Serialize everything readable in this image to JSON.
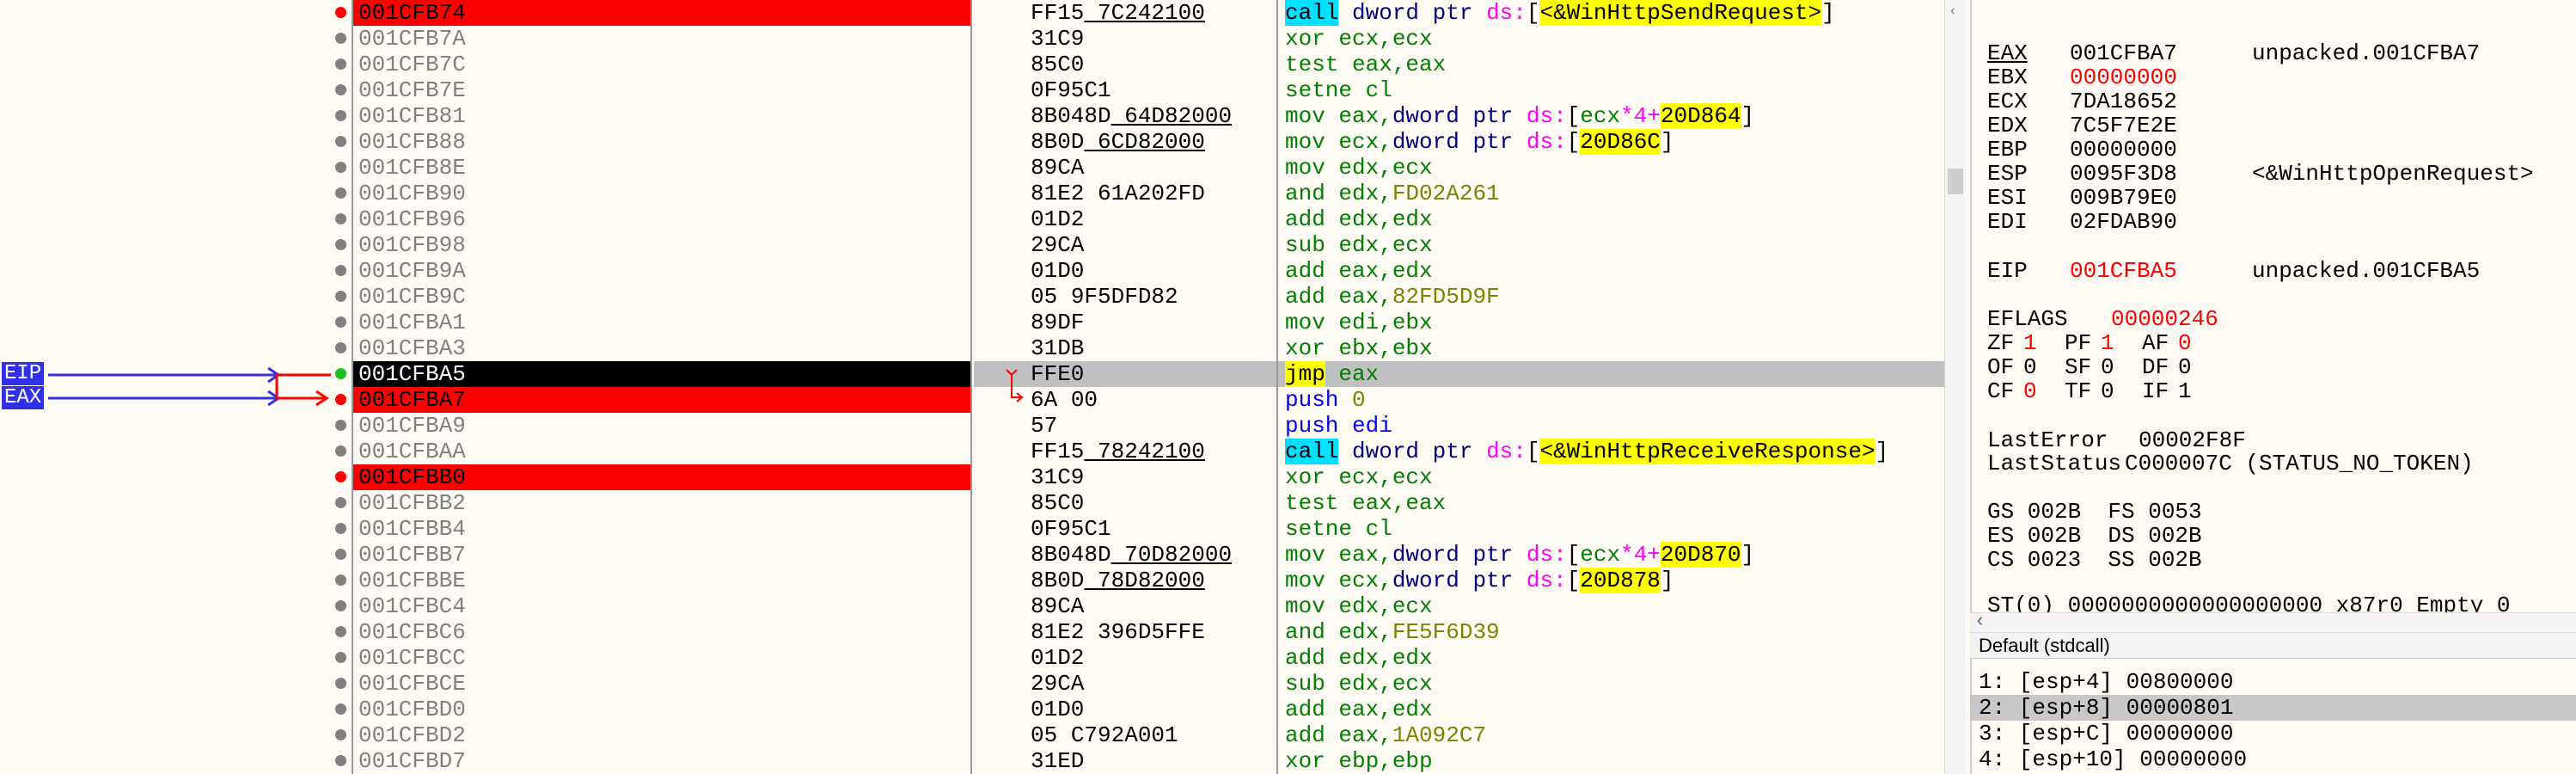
{
  "disasm": {
    "rows": [
      {
        "addr": "001CFB74",
        "bytes": "FF15 7C242100",
        "bp": "red",
        "addr_style": "bp",
        "instr": [
          [
            "call",
            "kw-call"
          ],
          [
            " dword ptr ",
            "ptr"
          ],
          [
            "ds:",
            "seg"
          ],
          [
            "[",
            "plain"
          ],
          [
            "<&WinHttpSendRequest>",
            "hl"
          ],
          [
            "]",
            "plain"
          ]
        ]
      },
      {
        "addr": "001CFB7A",
        "bytes": "31C9",
        "instr": [
          [
            "xor ecx,ecx",
            "k-mov"
          ]
        ]
      },
      {
        "addr": "001CFB7C",
        "bytes": "85C0",
        "instr": [
          [
            "test eax,eax",
            "k-mov"
          ]
        ]
      },
      {
        "addr": "001CFB7E",
        "bytes": "0F95C1",
        "instr": [
          [
            "setne cl",
            "k-mov"
          ]
        ]
      },
      {
        "addr": "001CFB81",
        "bytes": "8B048D 64D82000",
        "instr": [
          [
            "mov eax,",
            "k-mov"
          ],
          [
            "dword ptr ",
            "ptr"
          ],
          [
            "ds:",
            "seg"
          ],
          [
            "[",
            "plain"
          ],
          [
            "ecx",
            "k-mov"
          ],
          [
            "*4+",
            "seg"
          ],
          [
            "20D864",
            "hlc"
          ],
          [
            "]",
            "plain"
          ]
        ]
      },
      {
        "addr": "001CFB88",
        "bytes": "8B0D 6CD82000",
        "instr": [
          [
            "mov ecx,",
            "k-mov"
          ],
          [
            "dword ptr ",
            "ptr"
          ],
          [
            "ds:",
            "seg"
          ],
          [
            "[",
            "plain"
          ],
          [
            "20D86C",
            "hlc"
          ],
          [
            "]",
            "plain"
          ]
        ]
      },
      {
        "addr": "001CFB8E",
        "bytes": "89CA",
        "instr": [
          [
            "mov edx,ecx",
            "k-mov"
          ]
        ]
      },
      {
        "addr": "001CFB90",
        "bytes": "81E2 61A202FD",
        "instr": [
          [
            "and edx,",
            "k-mov"
          ],
          [
            "FD02A261",
            "num"
          ]
        ]
      },
      {
        "addr": "001CFB96",
        "bytes": "01D2",
        "instr": [
          [
            "add edx,edx",
            "k-mov"
          ]
        ]
      },
      {
        "addr": "001CFB98",
        "bytes": "29CA",
        "instr": [
          [
            "sub edx,ecx",
            "k-mov"
          ]
        ]
      },
      {
        "addr": "001CFB9A",
        "bytes": "01D0",
        "instr": [
          [
            "add eax,edx",
            "k-mov"
          ]
        ]
      },
      {
        "addr": "001CFB9C",
        "bytes": "05 9F5DFD82",
        "instr": [
          [
            "add eax,",
            "k-mov"
          ],
          [
            "82FD5D9F",
            "num"
          ]
        ]
      },
      {
        "addr": "001CFBA1",
        "bytes": "89DF",
        "instr": [
          [
            "mov edi,ebx",
            "k-mov"
          ]
        ]
      },
      {
        "addr": "001CFBA3",
        "bytes": "31DB",
        "instr": [
          [
            "xor ebx,ebx",
            "k-mov"
          ]
        ]
      },
      {
        "addr": "001CFBA5",
        "bytes": "FFE0",
        "bp": "green",
        "addr_style": "eip",
        "cur": true,
        "instr": [
          [
            "jmp",
            "kw-jmp"
          ],
          [
            " eax",
            "k-mov"
          ]
        ]
      },
      {
        "addr": "001CFBA7",
        "bytes": "6A 00",
        "bp": "red",
        "addr_style": "bp",
        "instr": [
          [
            "push ",
            "k-push"
          ],
          [
            "0",
            "num"
          ]
        ]
      },
      {
        "addr": "001CFBA9",
        "bytes": "57",
        "instr": [
          [
            "push edi",
            "k-push"
          ]
        ]
      },
      {
        "addr": "001CFBAA",
        "bytes": "FF15 78242100",
        "instr": [
          [
            "call",
            "kw-call"
          ],
          [
            " dword ptr ",
            "ptr"
          ],
          [
            "ds:",
            "seg"
          ],
          [
            "[",
            "plain"
          ],
          [
            "<&WinHttpReceiveResponse>",
            "hl"
          ],
          [
            "]",
            "plain"
          ]
        ]
      },
      {
        "addr": "001CFBB0",
        "bytes": "31C9",
        "bp": "red",
        "addr_style": "bp",
        "instr": [
          [
            "xor ecx,ecx",
            "k-mov"
          ]
        ]
      },
      {
        "addr": "001CFBB2",
        "bytes": "85C0",
        "instr": [
          [
            "test eax,eax",
            "k-mov"
          ]
        ]
      },
      {
        "addr": "001CFBB4",
        "bytes": "0F95C1",
        "instr": [
          [
            "setne cl",
            "k-mov"
          ]
        ]
      },
      {
        "addr": "001CFBB7",
        "bytes": "8B048D 70D82000",
        "instr": [
          [
            "mov eax,",
            "k-mov"
          ],
          [
            "dword ptr ",
            "ptr"
          ],
          [
            "ds:",
            "seg"
          ],
          [
            "[",
            "plain"
          ],
          [
            "ecx",
            "k-mov"
          ],
          [
            "*4+",
            "seg"
          ],
          [
            "20D870",
            "hlc"
          ],
          [
            "]",
            "plain"
          ]
        ]
      },
      {
        "addr": "001CFBBE",
        "bytes": "8B0D 78D82000",
        "instr": [
          [
            "mov ecx,",
            "k-mov"
          ],
          [
            "dword ptr ",
            "ptr"
          ],
          [
            "ds:",
            "seg"
          ],
          [
            "[",
            "plain"
          ],
          [
            "20D878",
            "hlc"
          ],
          [
            "]",
            "plain"
          ]
        ]
      },
      {
        "addr": "001CFBC4",
        "bytes": "89CA",
        "instr": [
          [
            "mov edx,ecx",
            "k-mov"
          ]
        ]
      },
      {
        "addr": "001CFBC6",
        "bytes": "81E2 396D5FFE",
        "instr": [
          [
            "and edx,",
            "k-mov"
          ],
          [
            "FE5F6D39",
            "num"
          ]
        ]
      },
      {
        "addr": "001CFBCC",
        "bytes": "01D2",
        "instr": [
          [
            "add edx,edx",
            "k-mov"
          ]
        ]
      },
      {
        "addr": "001CFBCE",
        "bytes": "29CA",
        "instr": [
          [
            "sub edx,ecx",
            "k-mov"
          ]
        ]
      },
      {
        "addr": "001CFBD0",
        "bytes": "01D0",
        "instr": [
          [
            "add eax,edx",
            "k-mov"
          ]
        ]
      },
      {
        "addr": "001CFBD2",
        "bytes": "05 C792A001",
        "instr": [
          [
            "add eax,",
            "k-mov"
          ],
          [
            "1A092C7",
            "num"
          ]
        ]
      },
      {
        "addr": "001CFBD7",
        "bytes": "31ED",
        "instr": [
          [
            "xor ebp,ebp",
            "k-mov"
          ]
        ]
      }
    ],
    "underlined_bytes": [
      "7C242100",
      "64D82000",
      "6CD82000",
      "78242100",
      "70D82000",
      "78D82000"
    ]
  },
  "arrows": {
    "eip_label": "EIP",
    "eax_label": "EAX"
  },
  "registers": {
    "general": [
      {
        "name": "EAX",
        "value": "001CFBA7",
        "comment": "unpacked.001CFBA7",
        "changed": false
      },
      {
        "name": "EBX",
        "value": "00000000",
        "comment": "",
        "changed": true
      },
      {
        "name": "ECX",
        "value": "7DA18652",
        "comment": "",
        "changed": false
      },
      {
        "name": "EDX",
        "value": "7C5F7E2E",
        "comment": "",
        "changed": false
      },
      {
        "name": "EBP",
        "value": "00000000",
        "comment": "",
        "changed": false
      },
      {
        "name": "ESP",
        "value": "0095F3D8",
        "comment": "<&WinHttpOpenRequest>",
        "changed": false
      },
      {
        "name": "ESI",
        "value": "009B79E0",
        "comment": "",
        "changed": false
      },
      {
        "name": "EDI",
        "value": "02FDAB90",
        "comment": "",
        "changed": false
      }
    ],
    "eip": {
      "name": "EIP",
      "value": "001CFBA5",
      "comment": "unpacked.001CFBA5"
    },
    "eflags": {
      "name": "EFLAGS",
      "value": "00000246"
    },
    "flags_rows": [
      [
        {
          "n": "ZF",
          "v": "1",
          "c": true
        },
        {
          "n": "PF",
          "v": "1",
          "c": true
        },
        {
          "n": "AF",
          "v": "0",
          "c": true
        }
      ],
      [
        {
          "n": "OF",
          "v": "0",
          "c": false
        },
        {
          "n": "SF",
          "v": "0",
          "c": false
        },
        {
          "n": "DF",
          "v": "0",
          "c": false
        }
      ],
      [
        {
          "n": "CF",
          "v": "0",
          "c": true
        },
        {
          "n": "TF",
          "v": "0",
          "c": false
        },
        {
          "n": "IF",
          "v": "1",
          "c": false
        }
      ]
    ],
    "last_error": {
      "label": "LastError",
      "value": "00002F8F"
    },
    "last_status": {
      "label": "LastStatus",
      "value": "C000007C (STATUS_NO_TOKEN)"
    },
    "segments": [
      "GS 002B  FS 0053",
      "ES 002B  DS 002B",
      "CS 0023  SS 002B"
    ],
    "fpu_partial": "ST(0) 0000000000000000000 x87r0 Empty 0"
  },
  "stack": {
    "convention": "Default (stdcall)",
    "args": [
      {
        "label": "1: [esp+4]",
        "value": "00800000",
        "selected": false
      },
      {
        "label": "2: [esp+8]",
        "value": "00000801",
        "selected": true
      },
      {
        "label": "3: [esp+C]",
        "value": "00000000",
        "selected": false
      },
      {
        "label": "4: [esp+10]",
        "value": "00000000",
        "selected": false
      }
    ]
  },
  "colors": {
    "breakpoint": "#ff0000",
    "eip_bg": "#000000",
    "arrow": "#3030e8"
  }
}
